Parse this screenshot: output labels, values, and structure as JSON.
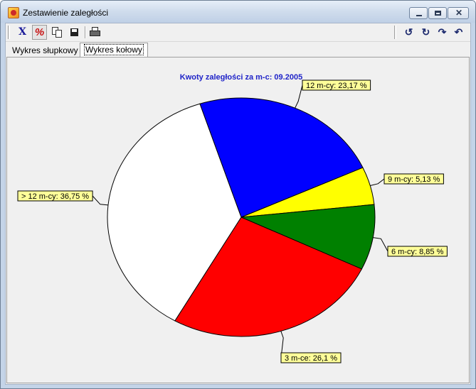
{
  "window": {
    "title": "Zestawienie zaległości",
    "icon": "app-icon"
  },
  "toolbar": {
    "x_label": "X",
    "pct_label": "%",
    "rotate_left_1": "↺",
    "rotate_right_1": "↻",
    "rotate_right_2": "↷",
    "rotate_left_2": "↶"
  },
  "tabs": [
    {
      "label": "Wykres słupkowy",
      "active": false
    },
    {
      "label": "Wykres kołowy",
      "active": true
    }
  ],
  "chart_data": {
    "type": "pie",
    "title": "Kwoty zaległości za m-c: 09.2005",
    "slices": [
      {
        "label": "12 m-cy: 23,17 %",
        "value": 23.17,
        "color": "#0000ff"
      },
      {
        "label": "9 m-cy: 5,13 %",
        "value": 5.13,
        "color": "#ffff00"
      },
      {
        "label": "6 m-cy: 8,85 %",
        "value": 8.85,
        "color": "#008000"
      },
      {
        "label": "3 m-ce: 26,1 %",
        "value": 26.1,
        "color": "#ff0000"
      },
      {
        "label": "> 12 m-cy: 36,75 %",
        "value": 36.75,
        "color": "#ffffff"
      }
    ],
    "start_angle_deg": -108,
    "label_background": "#ffff99"
  }
}
